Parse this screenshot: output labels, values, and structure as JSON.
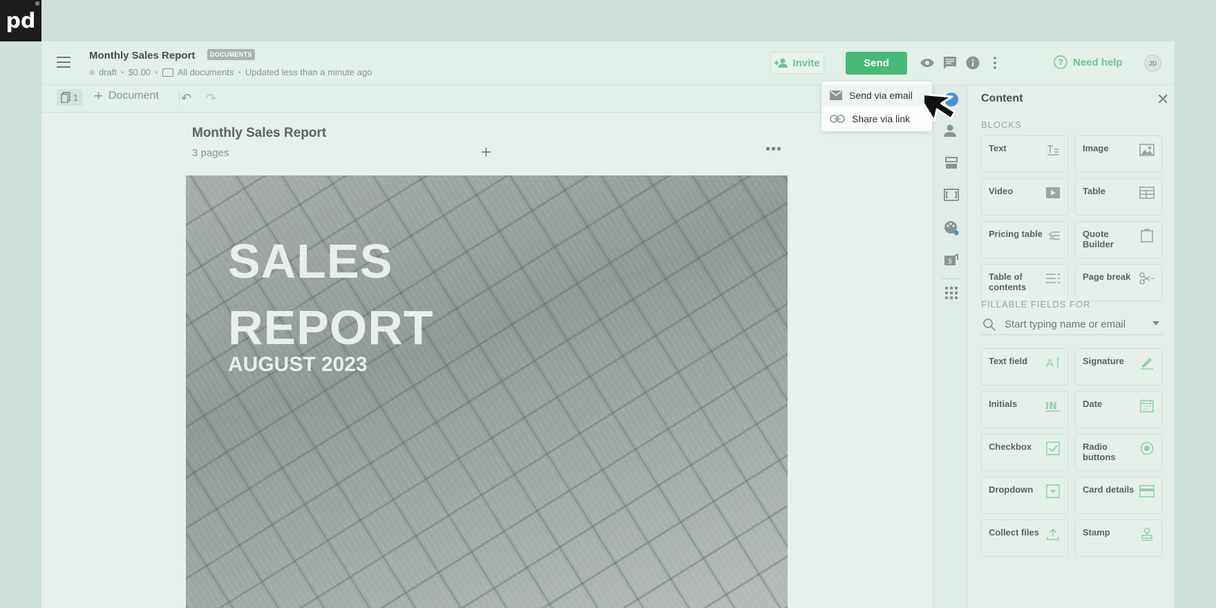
{
  "brand": {
    "logo": "pd",
    "reg": "®"
  },
  "header": {
    "doc_title": "Monthly Sales Report",
    "badge": "DOCUMENTS",
    "status": "draft",
    "amount": "$0.00",
    "folder": "All documents",
    "updated": "Updated less than a minute ago",
    "invite_label": "Invite",
    "send_label": "Send",
    "help_label": "Need help",
    "avatar_initials": "JD"
  },
  "toolbar": {
    "page_count": "1",
    "add_document_label": "Document"
  },
  "canvas": {
    "title": "Monthly Sales Report",
    "pages": "3 pages",
    "cover_line1": "SALES",
    "cover_line2": "REPORT",
    "cover_sub": "AUGUST 2023"
  },
  "send_menu": {
    "items": [
      {
        "label": "Send via email",
        "icon": "envelope-icon"
      },
      {
        "label": "Share via link",
        "icon": "link-icon"
      }
    ]
  },
  "panel": {
    "title": "Content",
    "blocks_label": "BLOCKS",
    "blocks": [
      {
        "label": "Text",
        "icon": "text-icon"
      },
      {
        "label": "Image",
        "icon": "image-icon"
      },
      {
        "label": "Video",
        "icon": "video-icon"
      },
      {
        "label": "Table",
        "icon": "table-icon"
      },
      {
        "label": "Pricing table",
        "icon": "pricing-table-icon"
      },
      {
        "label": "Quote Builder",
        "icon": "quote-builder-icon"
      },
      {
        "label": "Table of contents",
        "icon": "list-icon"
      },
      {
        "label": "Page break",
        "icon": "scissors-icon"
      }
    ],
    "fields_label": "FILLABLE FIELDS FOR",
    "search_placeholder": "Start typing name or email",
    "fields": [
      {
        "label": "Text field",
        "icon": "text-field-icon"
      },
      {
        "label": "Signature",
        "icon": "pen-icon"
      },
      {
        "label": "Initials",
        "icon": "initials-icon"
      },
      {
        "label": "Date",
        "icon": "calendar-icon"
      },
      {
        "label": "Checkbox",
        "icon": "checkbox-icon"
      },
      {
        "label": "Radio buttons",
        "icon": "radio-icon"
      },
      {
        "label": "Dropdown",
        "icon": "dropdown-icon"
      },
      {
        "label": "Card details",
        "icon": "credit-card-icon"
      },
      {
        "label": "Collect files",
        "icon": "upload-icon"
      },
      {
        "label": "Stamp",
        "icon": "stamp-icon"
      }
    ]
  },
  "colors": {
    "accent": "#47ba78",
    "accent_light": "#6cc597",
    "background": "#cfe0d9"
  }
}
